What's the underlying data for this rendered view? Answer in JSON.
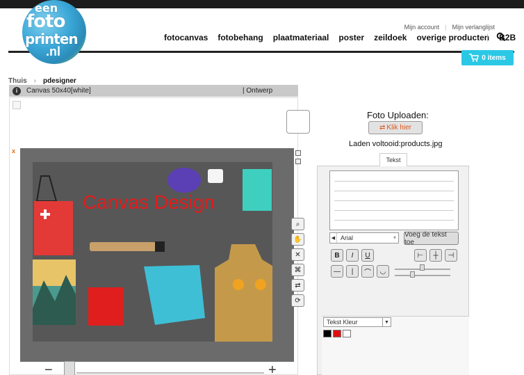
{
  "header": {
    "logo": [
      "een",
      "foto",
      "printen",
      ".nl"
    ],
    "toplinks": [
      "Mijn account",
      "Mijn verlanglijst"
    ],
    "nav": [
      "fotocanvas",
      "fotobehang",
      "plaatmateriaal",
      "poster",
      "zeildoek",
      "overige producten",
      "B2B"
    ],
    "cart_label": "0 items",
    "accent_color": "#2bc8e6"
  },
  "breadcrumb": {
    "home": "Thuis",
    "current": "pdesigner"
  },
  "designer": {
    "product_label": "Canvas 50x40[white]",
    "mode_label": "| Ontwerp",
    "canvas_text": "Canvas Design",
    "canvas_text_color": "#e21b1b",
    "delete_marker": "x"
  },
  "upload": {
    "title": "Foto Uploaden:",
    "button_label": "Klik hier",
    "status": "Laden voltooid:products.jpg"
  },
  "text_panel": {
    "tab_label": "Tekst",
    "font_value": "Arial",
    "add_text_label": "Voeg de tekst toe",
    "bold": "B",
    "italic": "I",
    "underline": "U",
    "color_label": "Tekst Kleur",
    "swatches": [
      "#000000",
      "#e01010",
      "#ffffff"
    ]
  }
}
